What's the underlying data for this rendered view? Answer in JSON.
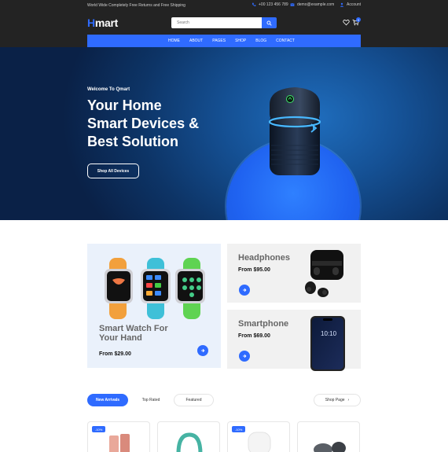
{
  "topbar": {
    "promo": "World Wide Completely Free Returns and Free Shipping",
    "phone": "+00 123 456 789",
    "email": "demo@example.com",
    "account": "Account",
    "logo_h": "H",
    "logo_rest": "mart",
    "search_placeholder": "Search",
    "cart_count": "0"
  },
  "nav": {
    "items": [
      "HOME",
      "ABOUT",
      "PAGES",
      "SHOP",
      "BLOG",
      "CONTACT"
    ]
  },
  "hero": {
    "welcome": "Welcome To Qmart",
    "title_line1": "Your Home",
    "title_line2": "Smart Devices &",
    "title_line3": "Best Solution",
    "button": "Shop All Devices"
  },
  "banners": {
    "watch": {
      "title_line1": "Smart Watch For",
      "title_line2": "Your Hand",
      "price": "From $29.00"
    },
    "headphones": {
      "title": "Headphones",
      "price": "From $95.00"
    },
    "smartphone": {
      "title": "Smartphone",
      "price": "From $69.00",
      "screen_time": "10:10"
    }
  },
  "tabs": {
    "new_arrivals": "New Arrivals",
    "top_rated": "Top Rated",
    "featured": "Featured",
    "shop_page": "Shop Page"
  },
  "products": [
    {
      "badge": "-10%"
    },
    {
      "badge": ""
    },
    {
      "badge": "-10%"
    },
    {
      "badge": ""
    }
  ],
  "colors": {
    "accent": "#2f6bff",
    "header_bg": "#232323",
    "hero_dark": "#0a2147"
  }
}
